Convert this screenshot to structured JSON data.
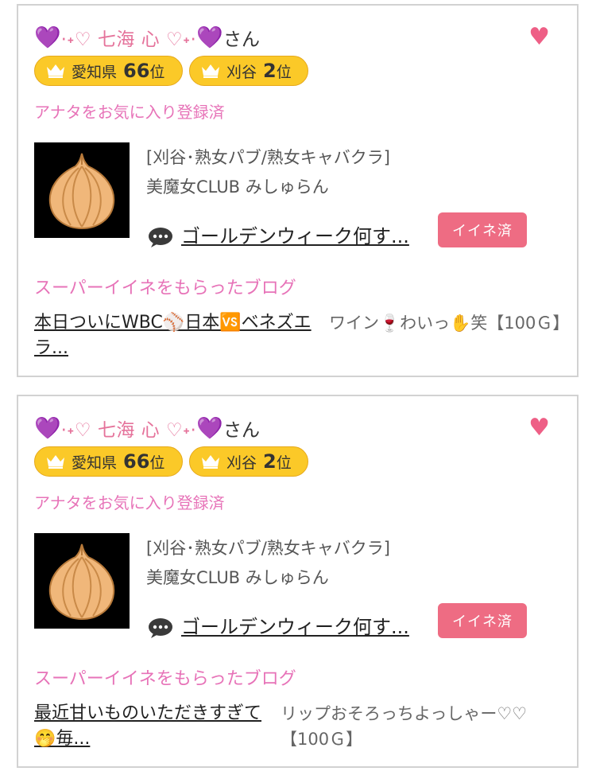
{
  "cards": [
    {
      "user": {
        "heart_left": "💜",
        "name": "·˖♡ 七海 心 ♡˖·",
        "heart_right": "💜",
        "suffix": "さん"
      },
      "rank_pref": {
        "label": "愛知県",
        "number": "66",
        "suffix": "位"
      },
      "rank_area": {
        "label": "刈谷",
        "number": "2",
        "suffix": "位"
      },
      "favorite_note": "アナタをお気に入り登録済",
      "shop": {
        "category": "[刈谷･熟女パブ/熟女キャバクラ]",
        "name": "美魔女CLUB みしゅらん"
      },
      "blog_title": "ゴールデンウィーク何す...",
      "iine_label": "イイネ済",
      "super_iine_label": "スーパーイイネをもらったブログ",
      "super_blog": {
        "title": "本日ついにWBC⚾日本🆚ベネズエラ...",
        "comment": "ワイン🍷わいっ✋笑【100Ｇ】"
      },
      "colors": {
        "accent": "#e773b8",
        "badge": "#fbc928",
        "button": "#ee6c83"
      }
    },
    {
      "user": {
        "heart_left": "💜",
        "name": "·˖♡ 七海 心 ♡˖·",
        "heart_right": "💜",
        "suffix": "さん"
      },
      "rank_pref": {
        "label": "愛知県",
        "number": "66",
        "suffix": "位"
      },
      "rank_area": {
        "label": "刈谷",
        "number": "2",
        "suffix": "位"
      },
      "favorite_note": "アナタをお気に入り登録済",
      "shop": {
        "category": "[刈谷･熟女パブ/熟女キャバクラ]",
        "name": "美魔女CLUB みしゅらん"
      },
      "blog_title": "ゴールデンウィーク何す...",
      "iine_label": "イイネ済",
      "super_iine_label": "スーパーイイネをもらったブログ",
      "super_blog": {
        "title": "最近甘いものいただきすぎて🤭毎...",
        "comment": "リップおそろっちよっしゃー♡♡【100Ｇ】"
      },
      "colors": {
        "accent": "#e773b8",
        "badge": "#fbc928",
        "button": "#ee6c83"
      }
    }
  ],
  "icons": {
    "like": "heart-icon",
    "crown": "crown-icon",
    "comment": "speech-bubble-icon",
    "shop_image": "onion-icon"
  }
}
